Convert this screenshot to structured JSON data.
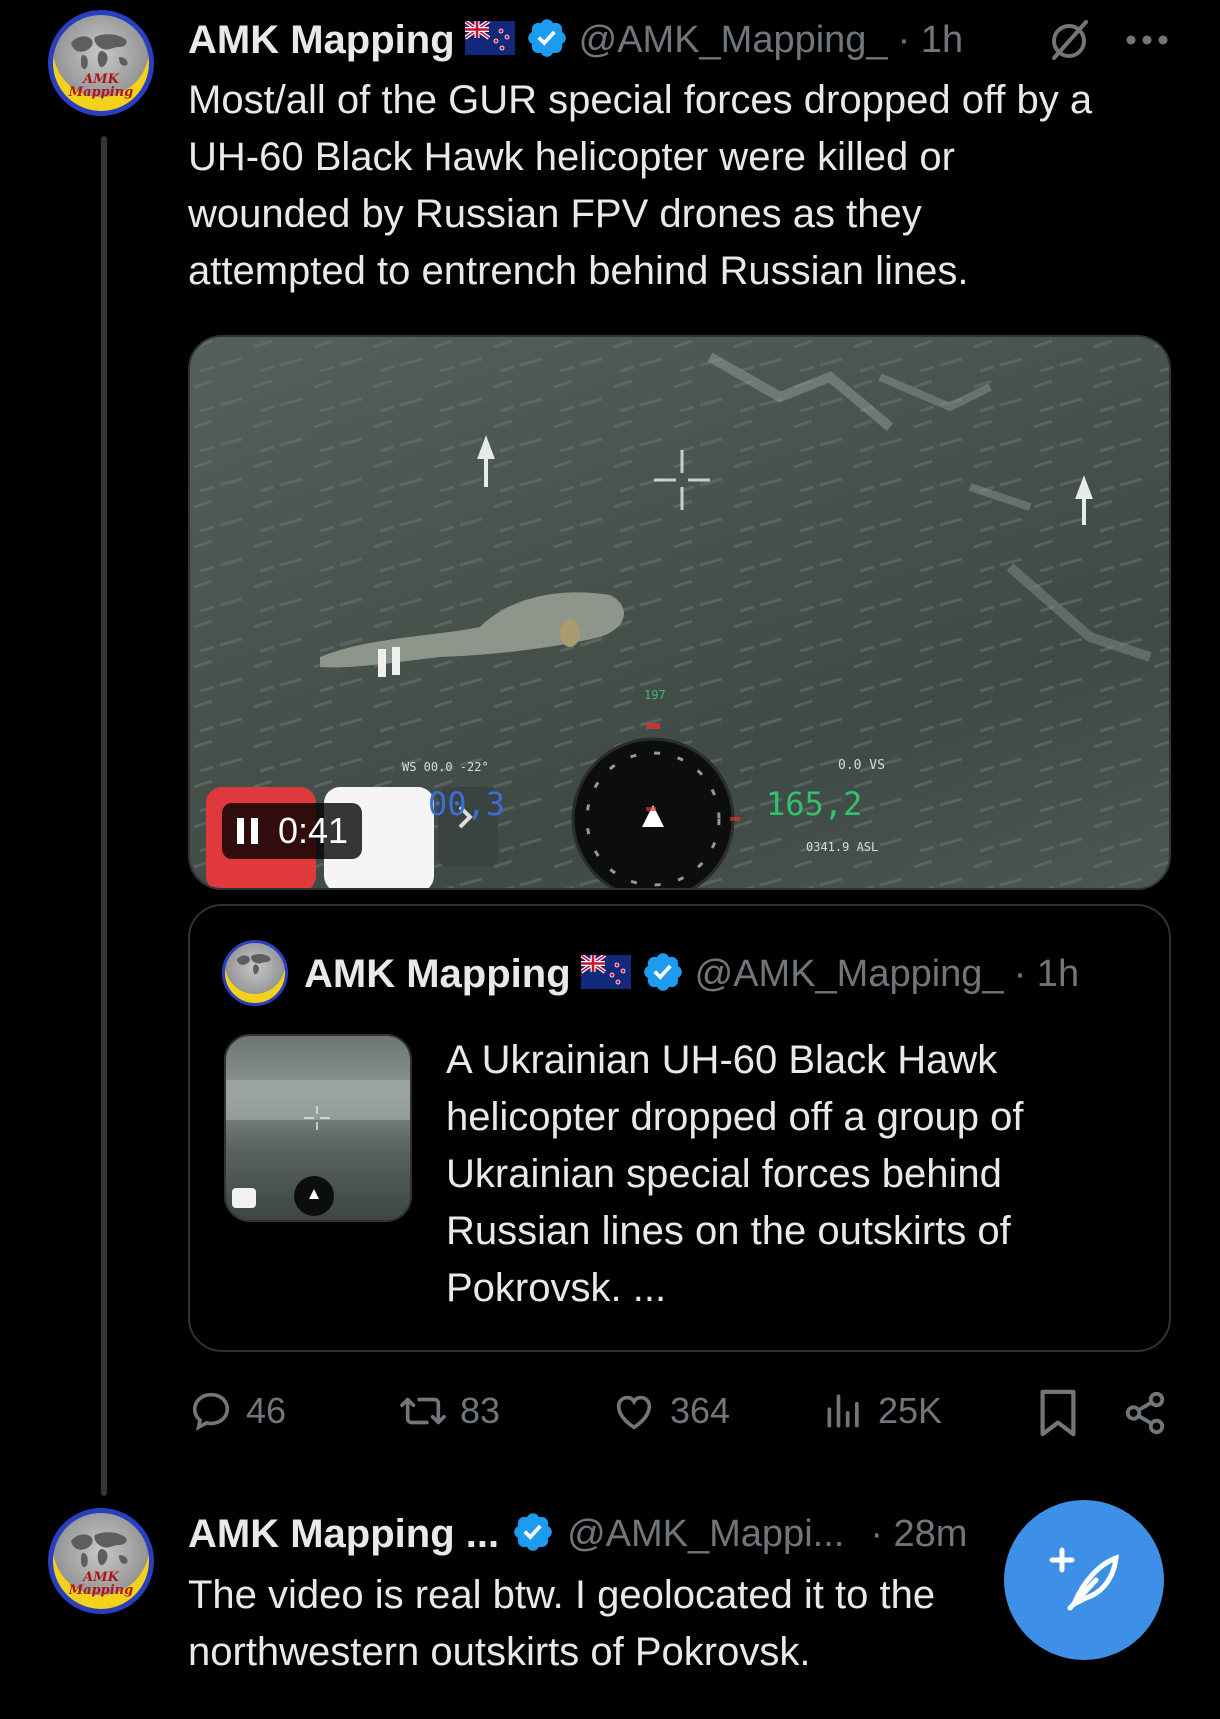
{
  "post1": {
    "author_name": "AMK Mapping",
    "handle": "@AMK_Mapping_",
    "time": "· 1h",
    "avatar_text": "AMK Mapping",
    "text_lines": [
      "Most/all of the GUR special forces dropped off by a",
      "UH-60 Black Hawk helicopter were killed or",
      "wounded by Russian FPV drones as they",
      "attempted to entrench behind Russian lines."
    ],
    "video": {
      "duration": "0:41",
      "hud_left_top": "WS 00.0   -22°",
      "hud_left_value": "00,3",
      "hud_right_top": "0.0 VS",
      "hud_speed": "165,2",
      "hud_alt": "0341.9 ASL",
      "hud_top": "197"
    },
    "quote": {
      "author_name": "AMK Mapping",
      "handle": "@AMK_Mapping_",
      "time": "· 1h",
      "text_lines": [
        "A Ukrainian UH-60 Black Hawk",
        "helicopter dropped off a group of",
        "Ukrainian special forces behind",
        "Russian lines on the outskirts of",
        "Pokrovsk. ..."
      ]
    },
    "actions": {
      "replies": "46",
      "reposts": "83",
      "likes": "364",
      "views": "25K"
    }
  },
  "post2": {
    "author_name": "AMK Mapping ...",
    "handle": "@AMK_Mappi...",
    "time": "· 28m",
    "avatar_text": "AMK Mapping",
    "text_lines": [
      "The video is real btw. I geolocated it to the",
      "northwestern outskirts of Pokrovsk."
    ]
  },
  "colors": {
    "background": "#000000",
    "text": "#e7e9ea",
    "secondary": "#71767b",
    "verified": "#1d9bf0",
    "fab": "#3e8fe6"
  }
}
